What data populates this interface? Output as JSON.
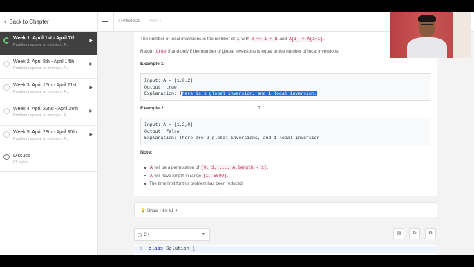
{
  "sidebar": {
    "back_label": "Back to Chapter",
    "weeks": [
      {
        "title": "Week 1: April 1st - April 7th",
        "sub": "Problems appear at midnight, P..."
      },
      {
        "title": "Week 2: April 8th - April 14th",
        "sub": "Problems appear at midnight, P..."
      },
      {
        "title": "Week 3: April 15th - April 21st",
        "sub": "Problems appear at midnight, P..."
      },
      {
        "title": "Week 4: April 22nd - April 28th",
        "sub": "Problems appear at midnight, P..."
      },
      {
        "title": "Week 5: April 29th - April 30th",
        "sub": "Problems appear at midnight, P..."
      }
    ],
    "discuss": {
      "title": "Discuss",
      "sub": "61 topics"
    }
  },
  "topbar": {
    "prev": "Previous",
    "next": "Next"
  },
  "problem": {
    "line1_pre": "The number of local inversions is the number of",
    "line1_code1": "i",
    "line1_mid": "with",
    "line1_code2": "0 <= i < N",
    "line1_and": "and",
    "line1_code3": "A[i] > A[i+1]",
    "line1_end": ".",
    "line2_pre": "Return",
    "line2_code": "true",
    "line2_post": "if and only if the number of global inversions is equal to the number of local inversions.",
    "example1_heading": "Example 1:",
    "example1_input": "Input: A = [1,0,2]",
    "example1_output": "Output: true",
    "example1_expl_pre": "Explanation: T",
    "example1_expl_sel": "here is 1 global inversion, and 1 local inversion.",
    "example2_heading": "Example 2:",
    "example2_input": "Input: A = [1,2,0]",
    "example2_output": "Output: false",
    "example2_expl": "Explanation: There are 2 global inversions, and 1 local inversion.",
    "note_heading": "Note:",
    "note1_code1": "A",
    "note1_text": "will be a permutation of",
    "note1_code2": "[0, 1, ..., A.length - 1]",
    "note1_end": ".",
    "note2_code1": "A",
    "note2_text": "will have length in range",
    "note2_code2": "[1, 5000]",
    "note2_end": ".",
    "note3": "The time limit for this problem has been reduced."
  },
  "hint": {
    "label": "Show Hint #1"
  },
  "editor": {
    "language": "C++",
    "line_number": "1",
    "keyword": "class",
    "code": "Solution {"
  }
}
